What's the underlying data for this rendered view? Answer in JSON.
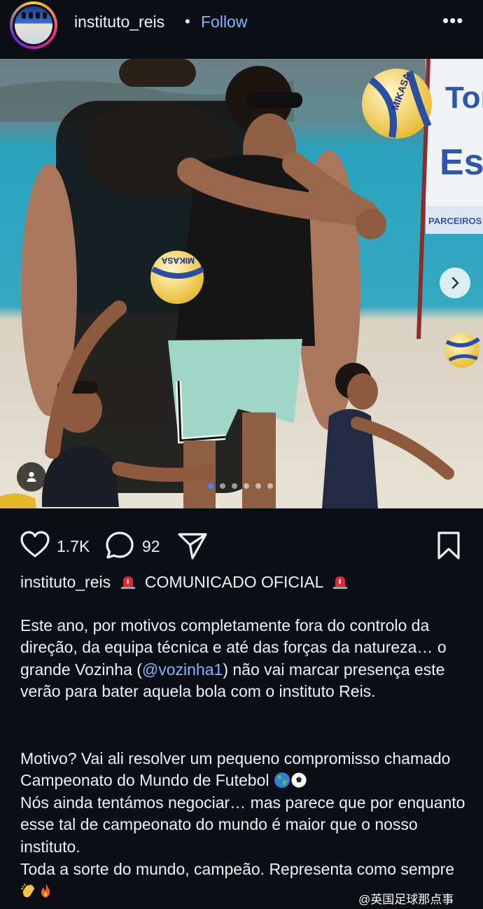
{
  "header": {
    "username": "instituto_reis",
    "separator": "•",
    "follow_label": "Follow",
    "more_label": "•••"
  },
  "carousel": {
    "current_index": 1,
    "total": 6
  },
  "actions": {
    "like_count": "1.7K",
    "comment_count": "92"
  },
  "caption": {
    "username": "instituto_reis",
    "headline": "COMUNICADO OFICIAL",
    "p1_before_mention": "Este ano, por motivos completamente fora do controlo da direção, da equipa técnica e até das forças da natureza… o grande Vozinha (",
    "mention": "@vozinha1",
    "p1_after_mention": ") não vai marcar presença este verão para bater aquela bola com o instituto Reis.",
    "p2": "Motivo? Vai ali resolver um pequeno compromisso chamado Campeonato do Mundo de Futebol",
    "p3": "Nós ainda tentámos negociar… mas parece que por enquanto esse tal de campeonato do mundo é maior que o nosso instituto.",
    "p4": "Toda a sorte do mundo, campeão. Representa como sempre"
  },
  "photo": {
    "banner_lines": [
      "Torc",
      "Esc",
      "PARCEIROS:"
    ],
    "ball_brand": "MIKASA"
  },
  "watermark": "@英国足球那点事",
  "colors": {
    "background": "#0b0e14",
    "link": "#8ab4ff",
    "dot_active": "#3d8cff"
  }
}
